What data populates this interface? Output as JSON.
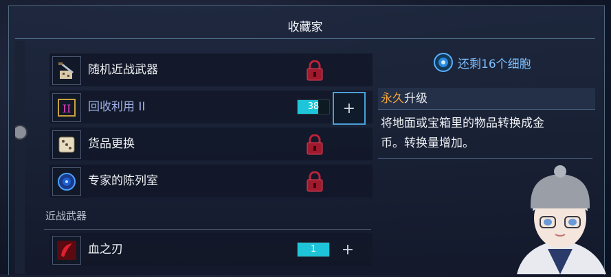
{
  "window": {
    "title": "收藏家"
  },
  "items": [
    {
      "name": "随机近战武器",
      "icon": "random-weapon-icon",
      "state": "locked"
    },
    {
      "name": "回收利用 II",
      "icon": "recycle-icon",
      "state": "cost",
      "cost": "38",
      "fill": 0.66
    },
    {
      "name": "货品更换",
      "icon": "dice-icon",
      "state": "locked"
    },
    {
      "name": "专家的陈列室",
      "icon": "showcase-icon",
      "state": "locked"
    }
  ],
  "section": {
    "label": "近战武器"
  },
  "section_items": [
    {
      "name": "血之刃",
      "icon": "blood-blade-icon",
      "state": "cost",
      "cost": "1",
      "fill": 1.0
    }
  ],
  "plus_label": "+",
  "details": {
    "cells_remaining": "还剩16个细胞",
    "permanent": "永久",
    "upgrade": "升级",
    "description_line1": "将地面或宝箱里的物品转换成金",
    "description_line2": "币。转换量增加。"
  },
  "colors": {
    "accent": "#1ec5d8",
    "permanent": "#f2a33a",
    "cells": "#7ec0ff",
    "lock": "#c0223a"
  }
}
